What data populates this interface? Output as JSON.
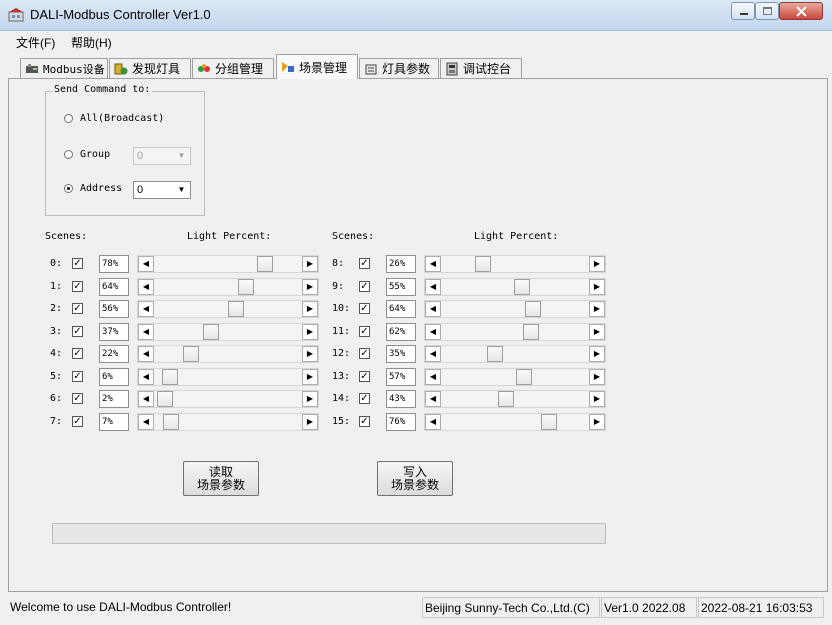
{
  "window": {
    "title": "DALI-Modbus Controller Ver1.0"
  },
  "menu": [
    {
      "label": "文件(F)"
    },
    {
      "label": "帮助(H)"
    }
  ],
  "tabs": [
    {
      "label": "Modbus设备"
    },
    {
      "label": "发现灯具"
    },
    {
      "label": "分组管理"
    },
    {
      "label": "场景管理"
    },
    {
      "label": "灯具参数"
    },
    {
      "label": "调试控台"
    }
  ],
  "send_command": {
    "legend": "Send Command to:",
    "broadcast_label": "All(Broadcast)",
    "group_label": "Group",
    "group_value": "0",
    "address_label": "Address",
    "address_value": "0",
    "selected": "address"
  },
  "scenes_header": {
    "left": "Scenes:",
    "right": "Light Percent:"
  },
  "scenes": [
    {
      "label": "0:",
      "checked": true,
      "percent": "78%",
      "value": 78
    },
    {
      "label": "1:",
      "checked": true,
      "percent": "64%",
      "value": 64
    },
    {
      "label": "2:",
      "checked": true,
      "percent": "56%",
      "value": 56
    },
    {
      "label": "3:",
      "checked": true,
      "percent": "37%",
      "value": 37
    },
    {
      "label": "4:",
      "checked": true,
      "percent": "22%",
      "value": 22
    },
    {
      "label": "5:",
      "checked": true,
      "percent": "6%",
      "value": 6
    },
    {
      "label": "6:",
      "checked": true,
      "percent": "2%",
      "value": 2
    },
    {
      "label": "7:",
      "checked": true,
      "percent": "7%",
      "value": 7
    },
    {
      "label": "8:",
      "checked": true,
      "percent": "26%",
      "value": 26
    },
    {
      "label": "9:",
      "checked": true,
      "percent": "55%",
      "value": 55
    },
    {
      "label": "10:",
      "checked": true,
      "percent": "64%",
      "value": 64
    },
    {
      "label": "11:",
      "checked": true,
      "percent": "62%",
      "value": 62
    },
    {
      "label": "12:",
      "checked": true,
      "percent": "35%",
      "value": 35
    },
    {
      "label": "13:",
      "checked": true,
      "percent": "57%",
      "value": 57
    },
    {
      "label": "14:",
      "checked": true,
      "percent": "43%",
      "value": 43
    },
    {
      "label": "15:",
      "checked": true,
      "percent": "76%",
      "value": 76
    }
  ],
  "buttons": {
    "read_line1": "读取",
    "read_line2": "场景参数",
    "write_line1": "写入",
    "write_line2": "场景参数"
  },
  "status": {
    "message": "Welcome to use DALI-Modbus Controller!",
    "company": "Beijing Sunny-Tech Co.,Ltd.(C)",
    "version": "Ver1.0 2022.08",
    "datetime": "2022-08-21 16:03:53"
  },
  "icons": {
    "tabs": [
      "modbus-device-icon",
      "lamp-discover-icon",
      "group-icon",
      "scene-icon",
      "lamp-param-icon",
      "console-icon"
    ]
  }
}
